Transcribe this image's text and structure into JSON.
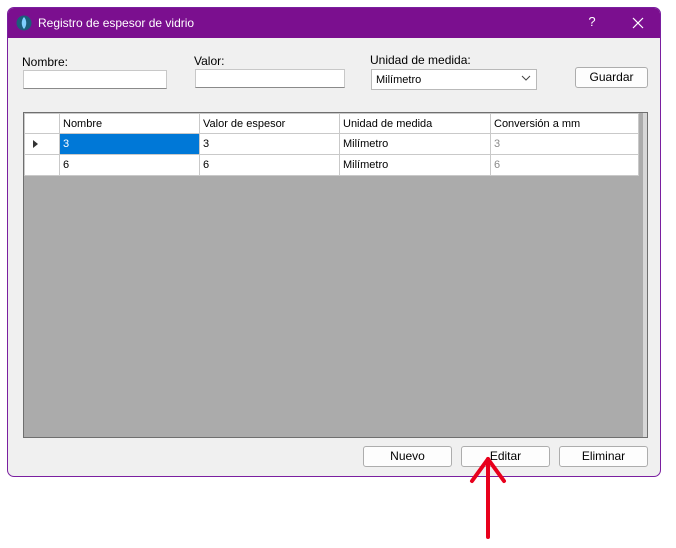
{
  "window": {
    "title": "Registro de espesor de vidrio",
    "help": "?",
    "close": "✕"
  },
  "form": {
    "nombre_label": "Nombre:",
    "nombre_value": "",
    "valor_label": "Valor:",
    "valor_value": "",
    "unidad_label": "Unidad de medida:",
    "unidad_selected": "Milímetro",
    "guardar": "Guardar"
  },
  "table": {
    "columns": [
      "Nombre",
      "Valor de espesor",
      "Unidad de medida",
      "Conversión a mm"
    ],
    "rows": [
      [
        "3",
        "3",
        "Milímetro",
        "3"
      ],
      [
        "6",
        "6",
        "Milímetro",
        "6"
      ]
    ]
  },
  "buttons": {
    "nuevo": "Nuevo",
    "editar": "Editar",
    "eliminar": "Eliminar"
  },
  "colors": {
    "titlebar": "#7b0f8f",
    "selection": "#0078d7",
    "annotation_arrow": "#e8001c"
  }
}
